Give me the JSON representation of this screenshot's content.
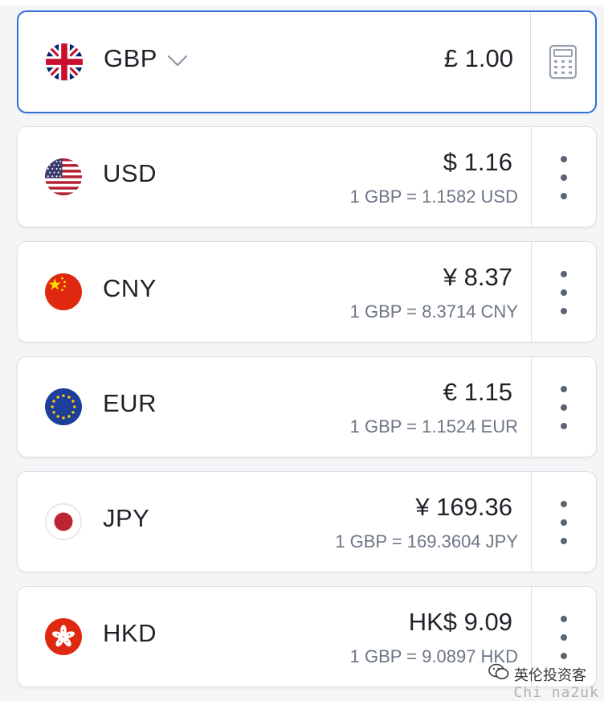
{
  "base": {
    "code": "GBP",
    "amount": "£ 1.00",
    "flag_icon": "uk-flag-icon",
    "calculator_icon": "calculator-icon",
    "chevron_icon": "chevron-down-icon"
  },
  "currencies": [
    {
      "code": "USD",
      "amount": "$ 1.16",
      "rate": "1 GBP = 1.1582 USD",
      "flag_icon": "us-flag-icon"
    },
    {
      "code": "CNY",
      "amount": "¥ 8.37",
      "rate": "1 GBP = 8.3714 CNY",
      "flag_icon": "china-flag-icon"
    },
    {
      "code": "EUR",
      "amount": "€ 1.15",
      "rate": "1 GBP = 1.1524 EUR",
      "flag_icon": "eu-flag-icon"
    },
    {
      "code": "JPY",
      "amount": "¥ 169.36",
      "rate": "1 GBP = 169.3604 JPY",
      "flag_icon": "japan-flag-icon"
    },
    {
      "code": "HKD",
      "amount": "HK$ 9.09",
      "rate": "1 GBP = 9.0897 HKD",
      "flag_icon": "hong-kong-flag-icon"
    }
  ],
  "watermark": {
    "text": "英伦投资客",
    "sub": "Chi  na2uk",
    "icon": "wechat-icon"
  },
  "colors": {
    "accent": "#2f6fd6",
    "text": "#1f2329",
    "muted": "#6d7686",
    "border": "#dcdfe4"
  }
}
